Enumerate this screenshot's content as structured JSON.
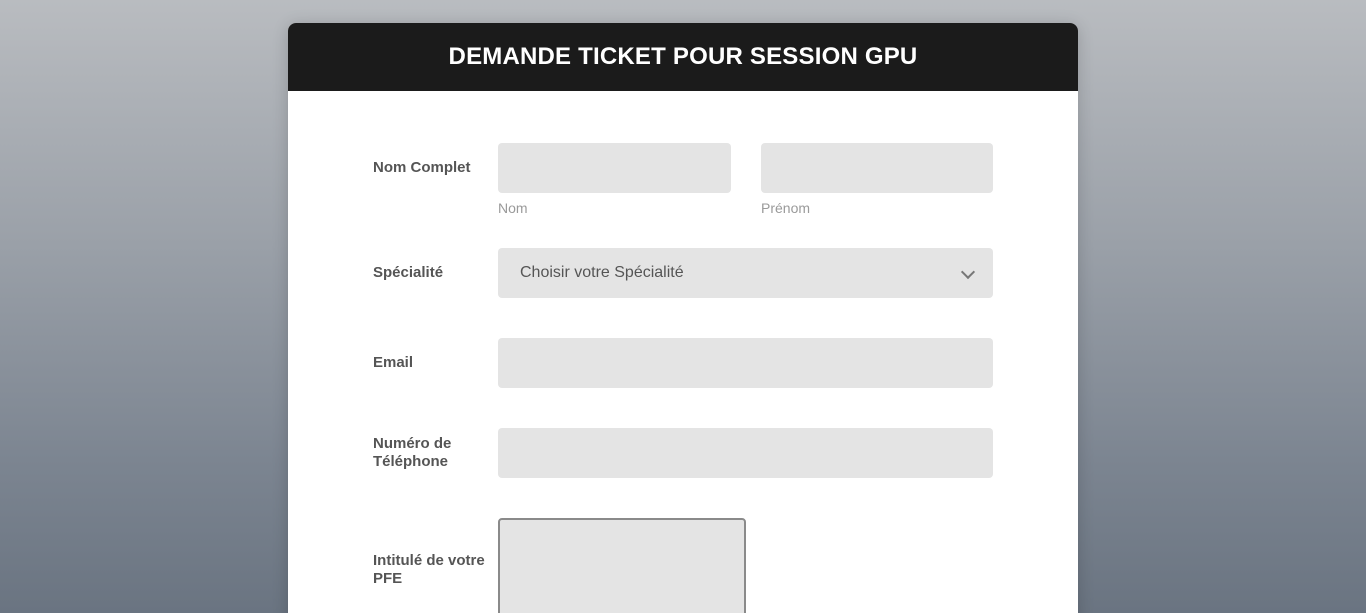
{
  "header": {
    "title": "DEMANDE TICKET POUR SESSION GPU"
  },
  "form": {
    "full_name": {
      "label": "Nom Complet",
      "last_name_hint": "Nom",
      "first_name_hint": "Prénom",
      "last_name_value": "",
      "first_name_value": ""
    },
    "specialty": {
      "label": "Spécialité",
      "selected": "Choisir votre Spécialité"
    },
    "email": {
      "label": "Email",
      "value": ""
    },
    "phone": {
      "label": "Numéro de Téléphone",
      "value": ""
    },
    "pfe_title": {
      "label": "Intitulé de votre PFE",
      "value": ""
    }
  },
  "colors": {
    "header_bg": "#1b1b1b",
    "field_bg": "#e4e4e4",
    "label_text": "#555555",
    "hint_text": "#9a9a9a"
  },
  "icons": {
    "select_arrow": "chevron-down-icon"
  }
}
